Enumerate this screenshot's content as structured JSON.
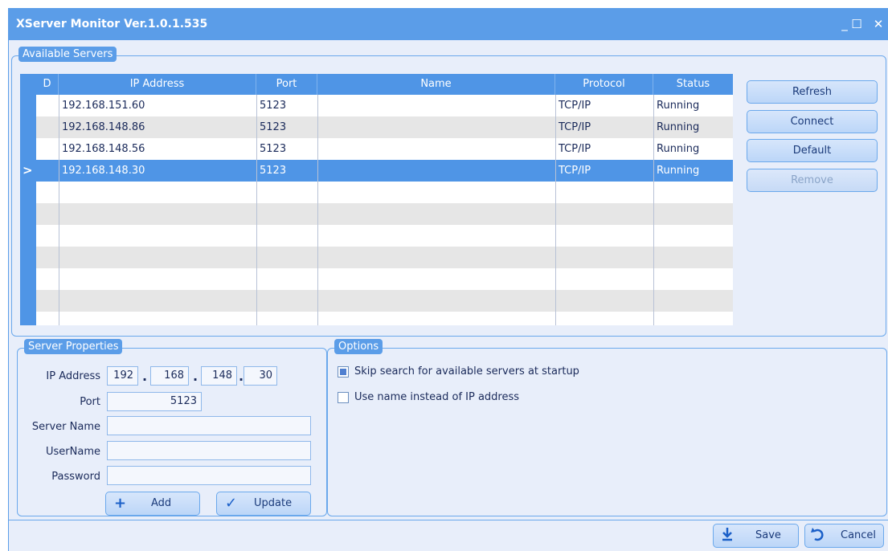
{
  "window": {
    "title": "XServer Monitor Ver.1.0.1.535",
    "minimize": "_",
    "maximize": "☐",
    "close": "✕"
  },
  "servers_group": {
    "label": "Available Servers",
    "columns": [
      "D",
      "IP Address",
      "Port",
      "Name",
      "Protocol",
      "Status"
    ],
    "rows": [
      {
        "ip": "192.168.151.60",
        "port": "5123",
        "name": "",
        "protocol": "TCP/IP",
        "status": "Running"
      },
      {
        "ip": "192.168.148.86",
        "port": "5123",
        "name": "",
        "protocol": "TCP/IP",
        "status": "Running"
      },
      {
        "ip": "192.168.148.56",
        "port": "5123",
        "name": "",
        "protocol": "TCP/IP",
        "status": "Running"
      },
      {
        "ip": "192.168.148.30",
        "port": "5123",
        "name": "",
        "protocol": "TCP/IP",
        "status": "Running"
      }
    ],
    "selected_pointer": ">"
  },
  "side_buttons": {
    "refresh": "Refresh",
    "connect": "Connect",
    "default": "Default",
    "remove": "Remove"
  },
  "properties": {
    "label": "Server Properties",
    "ip_label": "IP Address",
    "ip": [
      "192",
      "168",
      "148",
      "30"
    ],
    "ip_dot": ".",
    "port_label": "Port",
    "port": "5123",
    "server_name_label": "Server Name",
    "server_name": "",
    "username_label": "UserName",
    "username": "",
    "password_label": "Password",
    "password": "",
    "add_label": "Add",
    "update_label": "Update"
  },
  "options": {
    "label": "Options",
    "skip_search": {
      "label": "Skip search for available servers at startup",
      "checked": true
    },
    "use_name": {
      "label": "Use name instead of IP address",
      "checked": false
    }
  },
  "footer": {
    "save_label": "Save",
    "cancel_label": "Cancel"
  },
  "colors": {
    "accent": "#5b9de8",
    "selected_row": "#4f95e6",
    "background": "#e8eefa"
  }
}
